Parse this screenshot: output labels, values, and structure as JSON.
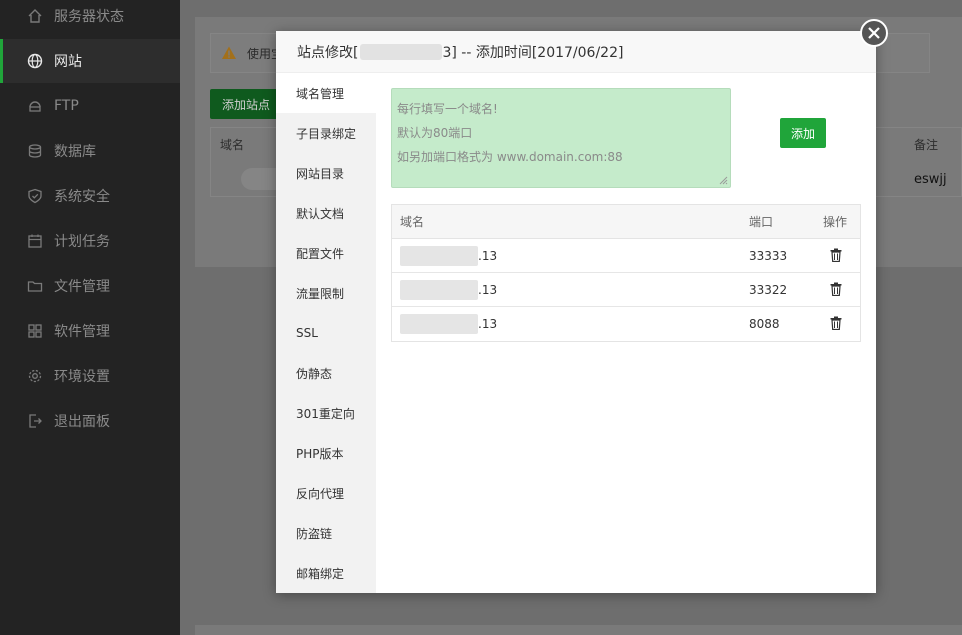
{
  "sidebar": {
    "items": [
      {
        "label": "服务器状态",
        "icon": "home-icon"
      },
      {
        "label": "网站",
        "icon": "globe-icon",
        "active": true
      },
      {
        "label": "FTP",
        "icon": "ftp-icon"
      },
      {
        "label": "数据库",
        "icon": "database-icon"
      },
      {
        "label": "系统安全",
        "icon": "shield-icon"
      },
      {
        "label": "计划任务",
        "icon": "calendar-icon"
      },
      {
        "label": "文件管理",
        "icon": "folder-icon"
      },
      {
        "label": "软件管理",
        "icon": "grid-icon"
      },
      {
        "label": "环境设置",
        "icon": "gear-icon"
      },
      {
        "label": "退出面板",
        "icon": "logout-icon"
      }
    ]
  },
  "background": {
    "alert_text": "使用宝",
    "add_site_label": "添加站点",
    "table_header_domain": "域名",
    "table_header_remark": "备注",
    "table_cell_remark": "eswjj"
  },
  "modal": {
    "title_prefix": "站点修改[",
    "title_suffix": "3] -- 添加时间[2017/06/22]",
    "tabs": [
      "域名管理",
      "子目录绑定",
      "网站目录",
      "默认文档",
      "配置文件",
      "流量限制",
      "SSL",
      "伪静态",
      "301重定向",
      "PHP版本",
      "反向代理",
      "防盗链",
      "邮箱绑定"
    ],
    "active_tab": 0,
    "textarea_placeholder_lines": [
      "每行填写一个域名!",
      "默认为80端口",
      "如另加端口格式为 www.domain.com:88"
    ],
    "add_label": "添加",
    "table": {
      "headers": {
        "domain": "域名",
        "port": "端口",
        "action": "操作"
      },
      "rows": [
        {
          "domain_visible": ".13",
          "port": "33333"
        },
        {
          "domain_visible": ".13",
          "port": "33322"
        },
        {
          "domain_visible": ".13",
          "port": "8088"
        }
      ]
    }
  },
  "colors": {
    "accent": "#20a53a",
    "sidebar_bg": "#232323",
    "textarea_bg": "#c5ebcb"
  }
}
